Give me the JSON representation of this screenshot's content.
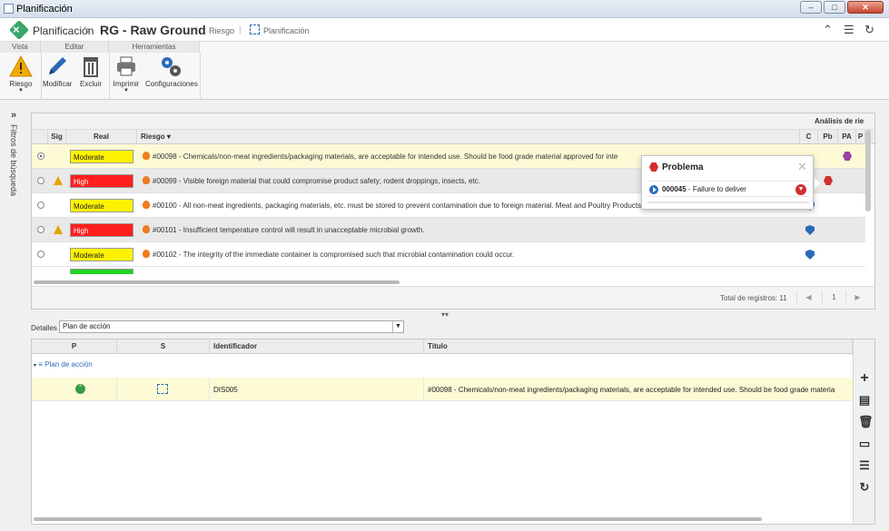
{
  "window": {
    "title": "Planificación"
  },
  "header": {
    "app": "Planificación",
    "record": "RG - Raw Ground",
    "crumb_riesgo": "Riesgo",
    "crumb_planificacion": "Planificación"
  },
  "ribbon": {
    "groups": {
      "vista": "Vista",
      "editar": "Editar",
      "herramientas": "Herramientas"
    },
    "riesgo": "Riesgo",
    "modificar": "Modificar",
    "excluir": "Excluir",
    "imprimir": "Imprimir",
    "configuraciones": "Configuraciones"
  },
  "sidebar": {
    "filters_label": "Filtros de búsqueda"
  },
  "grid": {
    "header_group": "Análisis de rie",
    "columns": {
      "sig": "Sig",
      "real": "Real",
      "riesgo": "Riesgo",
      "c": "C",
      "pb": "Pb",
      "pa": "PA",
      "p": "P"
    },
    "rows": [
      {
        "level": "Moderate",
        "text": "#00098 - Chemicals/non-meat ingredients/packaging materials, are acceptable for intended use. Should be food grade material approved for inte"
      },
      {
        "level": "High",
        "text": "#00099 - Visible foreign material that could compromise product safety; rodent droppings, insects, etc."
      },
      {
        "level": "Moderate",
        "text": "#00100 - All non-meat ingredients, packaging materials, etc. must be stored to prevent contamination due to foreign material. Meat and Poultry Products Hazards and Control Guide."
      },
      {
        "level": "High",
        "text": "#00101 - Insufficient temperature control will result in unacceptable microbial growth."
      },
      {
        "level": "Moderate",
        "text": "#00102 - The integrity of the immediate container is compromised such that microbial contamination could occur."
      }
    ],
    "footer": {
      "total": "Total de registros: 11",
      "page": "1"
    }
  },
  "popover": {
    "title": "Problema",
    "item": "000045 - Failure to deliver",
    "item_id": "000045",
    "item_desc": " - Failure to deliver"
  },
  "details": {
    "label": "Detalles",
    "select_value": "Plan de acción",
    "columns": {
      "p": "P",
      "s": "S",
      "id": "Identificador",
      "titulo": "Título"
    },
    "group": "Plan de acción",
    "row": {
      "id": "DIS005",
      "titulo": "#00098 - Chemicals/non-meat ingredients/packaging materials, are acceptable for intended use. Should be food grade materia"
    }
  },
  "colors": {
    "moderate": "#fff200",
    "high": "#ff1f1f",
    "low": "#21d321",
    "accent": "#2a6bb8",
    "selected_row": "#fdfbd6"
  }
}
